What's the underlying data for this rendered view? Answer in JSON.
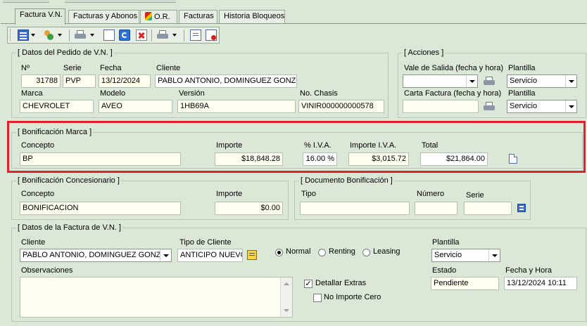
{
  "tabs": [
    {
      "label": "Factura V.N."
    },
    {
      "label": "Facturas y Abonos"
    },
    {
      "label": "O.R."
    },
    {
      "label": "Facturas"
    },
    {
      "label": "Historia Bloqueos"
    }
  ],
  "pedido": {
    "legend": "[ Datos del Pedido de V.N. ]",
    "labels": {
      "numero": "Nº",
      "serie": "Serie",
      "fecha": "Fecha",
      "cliente": "Cliente",
      "marca": "Marca",
      "modelo": "Modelo",
      "version": "Versión",
      "chasis": "No. Chasis"
    },
    "values": {
      "numero": "31788",
      "serie": "PVP",
      "fecha": "13/12/2024",
      "cliente": "PABLO  ANTONIO, DOMINGUEZ GONZ",
      "marca": "CHEVROLET",
      "modelo": "AVEO",
      "version": "1HB69A",
      "chasis": "VINIR000000000578"
    }
  },
  "acciones": {
    "legend": "[ Acciones ]",
    "vale_label": "Vale de Salida (fecha y hora)",
    "carta_label": "Carta Factura (fecha y hora)",
    "plantilla_label": "Plantilla",
    "plantilla1": "Servicio",
    "plantilla2": "Servicio",
    "vale_value": "",
    "carta_value": ""
  },
  "bonif_marca": {
    "legend": "[ Bonificación Marca ]",
    "labels": {
      "concepto": "Concepto",
      "importe": "Importe",
      "iva_pct": "% I.V.A.",
      "importe_iva": "Importe I.V.A.",
      "total": "Total"
    },
    "values": {
      "concepto": "BP",
      "importe": "$18,848.28",
      "iva_pct": "16.00 %",
      "importe_iva": "$3,015.72",
      "total": "$21,864.00"
    }
  },
  "bonif_conces": {
    "legend": "[ Bonificación Concesionario ]",
    "labels": {
      "concepto": "Concepto",
      "importe": "Importe"
    },
    "values": {
      "concepto": "BONIFICACION",
      "importe": "$0.00"
    }
  },
  "doc_bonif": {
    "legend": "[ Documento Bonificación ]",
    "labels": {
      "tipo": "Tipo",
      "numero": "Número",
      "serie": "Serie"
    },
    "values": {
      "tipo": "",
      "numero": "",
      "serie": ""
    }
  },
  "factura": {
    "legend": "[ Datos de la Factura de V.N. ]",
    "labels": {
      "cliente": "Cliente",
      "tipo_cliente": "Tipo de Cliente",
      "observaciones": "Observaciones",
      "plantilla": "Plantilla",
      "estado": "Estado",
      "fecha_hora": "Fecha y Hora"
    },
    "values": {
      "cliente": "PABLO  ANTONIO, DOMINGUEZ GONZ",
      "tipo_cliente": "ANTICIPO NUEVO",
      "plantilla": "Servicio",
      "estado": "Pendiente",
      "fecha_hora": "13/12/2024 10:11",
      "observaciones": ""
    },
    "radios": [
      {
        "label": "Normal",
        "checked": true
      },
      {
        "label": "Renting",
        "checked": false
      },
      {
        "label": "Leasing",
        "checked": false
      }
    ],
    "detallar_extras": {
      "label": "Detallar Extras",
      "checked": true
    },
    "no_importe_cero": {
      "label": "No Importe Cero",
      "checked": false
    }
  },
  "colors": {
    "background": "#dbe8d8",
    "field": "#fffff0",
    "highlight": "#e0222a"
  }
}
